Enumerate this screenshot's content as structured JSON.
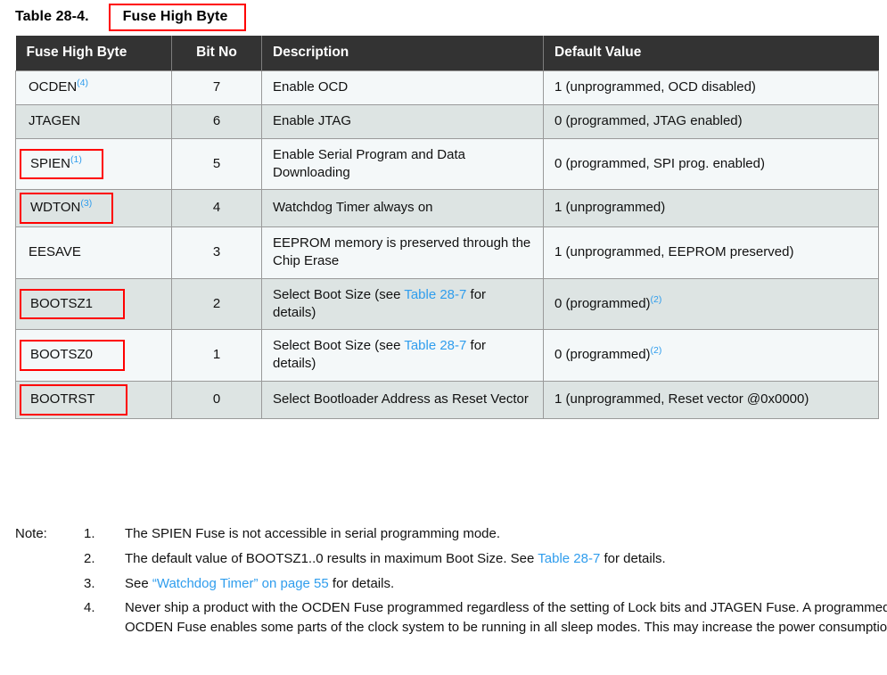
{
  "caption": {
    "label": "Table 28-4.",
    "title": "Fuse High Byte",
    "highlight_color": "#ff0000"
  },
  "table": {
    "headers": {
      "name": "Fuse High Byte",
      "bit": "Bit No",
      "description": "Description",
      "default": "Default Value"
    },
    "header_bg": "#333333",
    "row_bg_odd": "#f4f8f9",
    "row_bg_even": "#dde4e3",
    "link_color": "#2f9ded",
    "rows": [
      {
        "name": "OCDEN",
        "name_sup": "(4)",
        "boxed": false,
        "bit": "7",
        "desc_pre": "Enable OCD",
        "desc_link": "",
        "desc_post": "",
        "default_pre": "1 (unprogrammed, OCD disabled)",
        "default_sup": ""
      },
      {
        "name": "JTAGEN",
        "name_sup": "",
        "boxed": false,
        "bit": "6",
        "desc_pre": "Enable JTAG",
        "desc_link": "",
        "desc_post": "",
        "default_pre": "0 (programmed, JTAG enabled)",
        "default_sup": ""
      },
      {
        "name": "SPIEN",
        "name_sup": "(1)",
        "boxed": true,
        "bit": "5",
        "desc_pre": "Enable Serial Program and Data Downloading",
        "desc_link": "",
        "desc_post": "",
        "default_pre": "0 (programmed, SPI prog. enabled)",
        "default_sup": ""
      },
      {
        "name": "WDTON",
        "name_sup": "(3)",
        "boxed": true,
        "bit": "4",
        "desc_pre": "Watchdog Timer always on",
        "desc_link": "",
        "desc_post": "",
        "default_pre": "1 (unprogrammed)",
        "default_sup": ""
      },
      {
        "name": "EESAVE",
        "name_sup": "",
        "boxed": false,
        "bit": "3",
        "desc_pre": "EEPROM memory is preserved through the Chip Erase",
        "desc_link": "",
        "desc_post": "",
        "default_pre": "1 (unprogrammed, EEPROM preserved)",
        "default_sup": ""
      },
      {
        "name": "BOOTSZ1",
        "name_sup": "",
        "boxed": true,
        "bit": "2",
        "desc_pre": "Select Boot Size (see ",
        "desc_link": "Table 28-7",
        "desc_post": " for details)",
        "default_pre": "0 (programmed)",
        "default_sup": "(2)"
      },
      {
        "name": "BOOTSZ0",
        "name_sup": "",
        "boxed": true,
        "bit": "1",
        "desc_pre": "Select Boot Size (see ",
        "desc_link": "Table 28-7",
        "desc_post": " for details)",
        "default_pre": "0 (programmed)",
        "default_sup": "(2)"
      },
      {
        "name": "BOOTRST",
        "name_sup": "",
        "boxed": true,
        "bit": "0",
        "desc_pre": "Select Bootloader Address as Reset Vector",
        "desc_link": "",
        "desc_post": "",
        "default_pre": "1 (unprogrammed, Reset vector @0x0000)",
        "default_sup": ""
      }
    ]
  },
  "notes": {
    "heading": "Note:",
    "items": [
      {
        "num": "1.",
        "pre": "The SPIEN Fuse is not accessible in serial programming mode.",
        "link": "",
        "post": ""
      },
      {
        "num": "2.",
        "pre": "The default value of BOOTSZ1..0 results in maximum Boot Size. See ",
        "link": "Table 28-7",
        "post": " for details."
      },
      {
        "num": "3.",
        "pre": "See ",
        "link": "“Watchdog Timer” on page 55",
        "post": " for details."
      },
      {
        "num": "4.",
        "pre": "Never ship a product with the OCDEN Fuse programmed regardless of the setting of Lock bits and JTAGEN Fuse. A programmed OCDEN Fuse enables some parts of the clock system to be running in all sleep modes. This may increase the power consumption.",
        "link": "",
        "post": ""
      }
    ]
  }
}
